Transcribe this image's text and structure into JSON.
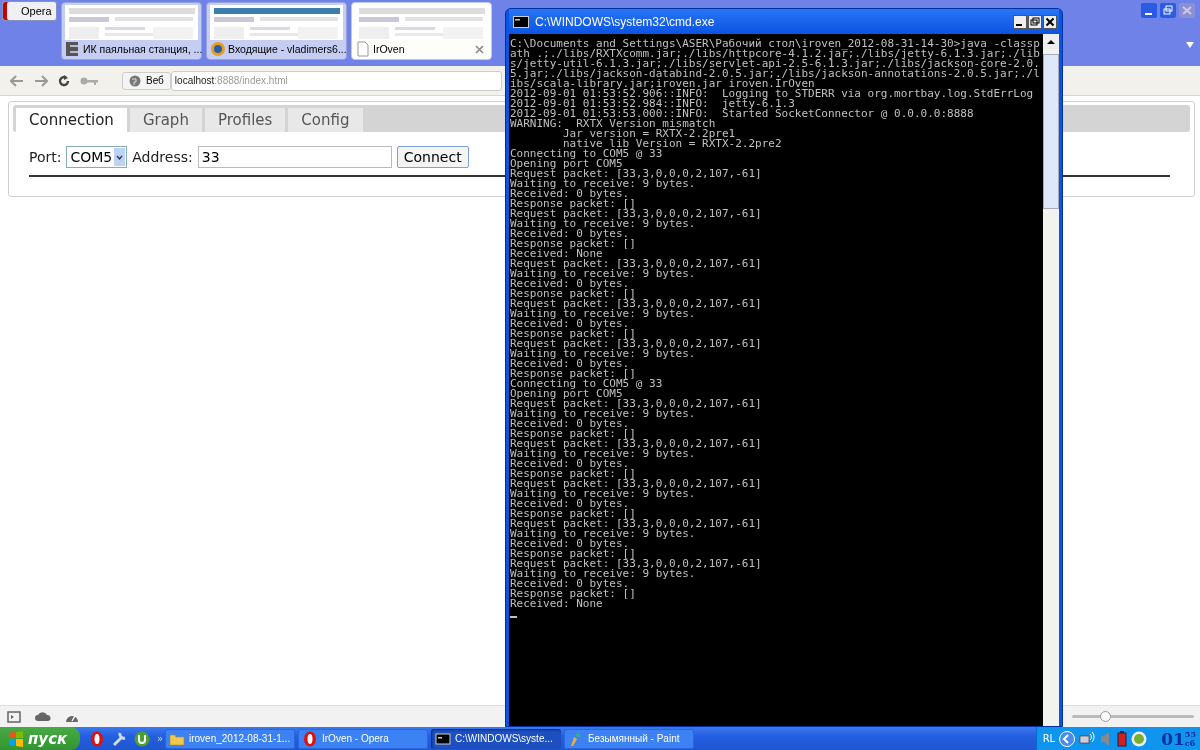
{
  "browser": {
    "menu_button": "Opera",
    "tabs": [
      {
        "title": "ИК паяльная станция, ...",
        "kind": "square-logo",
        "selected": false
      },
      {
        "title": "Входящие - vladimers6...",
        "kind": "round-logo",
        "selected": false
      },
      {
        "title": "IrOven",
        "kind": "page",
        "selected": true
      }
    ],
    "web_button": "Веб",
    "url_host": "localhost",
    "url_rest": ":8888/index.html"
  },
  "page": {
    "tabs": [
      {
        "label": "Connection",
        "selected": true
      },
      {
        "label": "Graph",
        "selected": false
      },
      {
        "label": "Profiles",
        "selected": false
      },
      {
        "label": "Config",
        "selected": false
      }
    ],
    "port_label": "Port:",
    "port_value": "COM5",
    "address_label": "Address:",
    "address_value": "33",
    "connect_button": "Connect"
  },
  "status_bar": {
    "zoom": {
      "level": 0.27
    }
  },
  "taskbar": {
    "start": "пуск",
    "quick_launch_more": "»",
    "tasks": [
      {
        "title": "iroven_2012-08-31-1...",
        "kind": "folder",
        "selected": false
      },
      {
        "title": "IrOven - Opera",
        "kind": "opera",
        "selected": false
      },
      {
        "title": "C:\\WINDOWS\\syste...",
        "kind": "console",
        "selected": true
      },
      {
        "title": "Безымянный - Paint",
        "kind": "paint",
        "selected": false
      }
    ],
    "tray_language": "RL",
    "clock_hour": "01",
    "clock_minute": "55",
    "clock_day": "сб"
  },
  "console": {
    "title": "C:\\WINDOWS\\system32\\cmd.exe",
    "lines": [
      "C:\\Documents and Settings\\ASER\\Рабочий стол\\iroven_2012-08-31-14-30>java -classp",
      "ath .;./libs/RXTXcomm.jar;./libs/httpcore-4.1.2.jar;./libs/jetty-6.1.3.jar;./lib",
      "s/jetty-util-6.1.3.jar;./libs/servlet-api-2.5-6.1.3.jar;./libs/jackson-core-2.0.",
      "5.jar;./libs/jackson-databind-2.0.5.jar;./libs/jackson-annotations-2.0.5.jar;./l",
      "ibs/scala-library.jar;iroven.jar iroven.IrOven",
      "2012-09-01 01:53:52.906::INFO:  Logging to STDERR via org.mortbay.log.StdErrLog",
      "2012-09-01 01:53:52.984::INFO:  jetty-6.1.3",
      "2012-09-01 01:53:53.000::INFO:  Started SocketConnector @ 0.0.0.0:8888",
      "WARNING:  RXTX Version mismatch",
      "        Jar version = RXTX-2.2pre1",
      "        native lib Version = RXTX-2.2pre2",
      "Connecting to COM5 @ 33",
      "Opening port COM5",
      "Request packet: [33,3,0,0,0,2,107,-61]",
      "Waiting to receive: 9 bytes.",
      "Received: 0 bytes.",
      "Response packet: []",
      "Request packet: [33,3,0,0,0,2,107,-61]",
      "Waiting to receive: 9 bytes.",
      "Received: 0 bytes.",
      "Response packet: []",
      "Received: None",
      "Request packet: [33,3,0,0,0,2,107,-61]",
      "Waiting to receive: 9 bytes.",
      "Received: 0 bytes.",
      "Response packet: []",
      "Request packet: [33,3,0,0,0,2,107,-61]",
      "Waiting to receive: 9 bytes.",
      "Received: 0 bytes.",
      "Response packet: []",
      "Request packet: [33,3,0,0,0,2,107,-61]",
      "Waiting to receive: 9 bytes.",
      "Received: 0 bytes.",
      "Response packet: []",
      "Connecting to COM5 @ 33",
      "Opening port COM5",
      "Request packet: [33,3,0,0,0,2,107,-61]",
      "Waiting to receive: 9 bytes.",
      "Received: 0 bytes.",
      "Response packet: []",
      "Request packet: [33,3,0,0,0,2,107,-61]",
      "Waiting to receive: 9 bytes.",
      "Received: 0 bytes.",
      "Response packet: []",
      "Request packet: [33,3,0,0,0,2,107,-61]",
      "Waiting to receive: 9 bytes.",
      "Received: 0 bytes.",
      "Response packet: []",
      "Request packet: [33,3,0,0,0,2,107,-61]",
      "Waiting to receive: 9 bytes.",
      "Received: 0 bytes.",
      "Response packet: []",
      "Request packet: [33,3,0,0,0,2,107,-61]",
      "Waiting to receive: 9 bytes.",
      "Received: 0 bytes.",
      "Response packet: []",
      "Received: None"
    ]
  }
}
